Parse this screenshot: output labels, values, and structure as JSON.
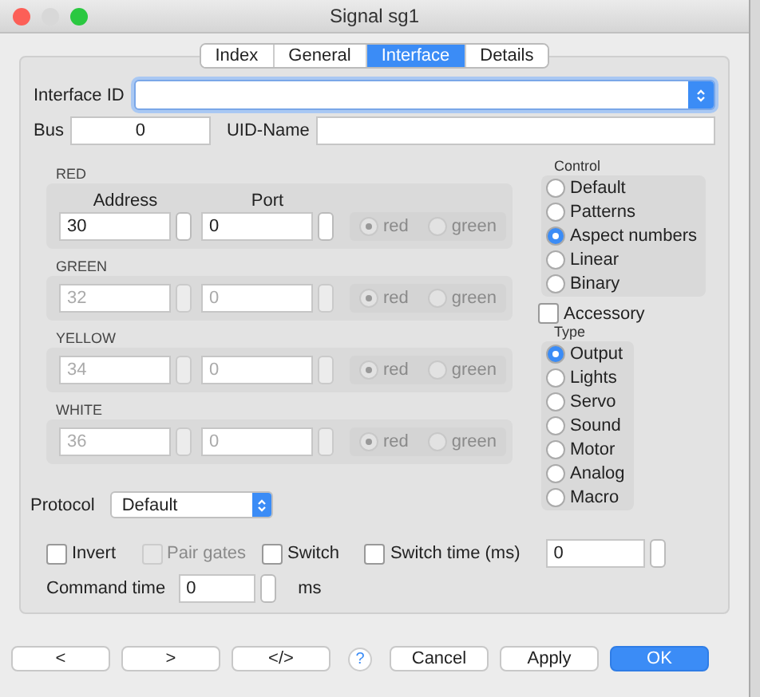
{
  "window": {
    "title": "Signal sg1"
  },
  "tabs": [
    {
      "label": "Index",
      "selected": false
    },
    {
      "label": "General",
      "selected": false
    },
    {
      "label": "Interface",
      "selected": true
    },
    {
      "label": "Details",
      "selected": false
    }
  ],
  "interface_id": {
    "label": "Interface ID"
  },
  "bus": {
    "label": "Bus",
    "value": "0"
  },
  "uid_name": {
    "label": "UID-Name"
  },
  "address_header": "Address",
  "port_header": "Port",
  "outputs": [
    {
      "label": "RED",
      "disabled": false,
      "address": "30",
      "port": "0",
      "options": [
        {
          "label": "red",
          "selected": true
        },
        {
          "label": "green",
          "selected": false
        }
      ]
    },
    {
      "label": "GREEN",
      "disabled": true,
      "address": "32",
      "port": "0",
      "options": [
        {
          "label": "red",
          "selected": true
        },
        {
          "label": "green",
          "selected": false
        }
      ]
    },
    {
      "label": "YELLOW",
      "disabled": true,
      "address": "34",
      "port": "0",
      "options": [
        {
          "label": "red",
          "selected": true
        },
        {
          "label": "green",
          "selected": false
        }
      ]
    },
    {
      "label": "WHITE",
      "disabled": true,
      "address": "36",
      "port": "0",
      "options": [
        {
          "label": "red",
          "selected": true
        },
        {
          "label": "green",
          "selected": false
        }
      ]
    }
  ],
  "control": {
    "title": "Control",
    "options": [
      {
        "label": "Default",
        "selected": false
      },
      {
        "label": "Patterns",
        "selected": false
      },
      {
        "label": "Aspect numbers",
        "selected": true
      },
      {
        "label": "Linear",
        "selected": false
      },
      {
        "label": "Binary",
        "selected": false
      }
    ]
  },
  "accessory": {
    "label": "Accessory",
    "checked": false
  },
  "type": {
    "title": "Type",
    "options": [
      {
        "label": "Output",
        "selected": true
      },
      {
        "label": "Lights",
        "selected": false
      },
      {
        "label": "Servo",
        "selected": false
      },
      {
        "label": "Sound",
        "selected": false
      },
      {
        "label": "Motor",
        "selected": false
      },
      {
        "label": "Analog",
        "selected": false
      },
      {
        "label": "Macro",
        "selected": false
      }
    ]
  },
  "protocol": {
    "label": "Protocol",
    "value": "Default"
  },
  "flags": [
    {
      "label": "Invert",
      "checked": false,
      "disabled": false
    },
    {
      "label": "Pair gates",
      "checked": false,
      "disabled": true
    },
    {
      "label": "Switch",
      "checked": false,
      "disabled": false
    },
    {
      "label": "Switch time (ms)",
      "checked": false,
      "disabled": false
    }
  ],
  "switch_time": {
    "value": "0"
  },
  "command_time": {
    "label": "Command time",
    "value": "0",
    "unit": "ms"
  },
  "buttons": [
    {
      "label": "<",
      "kind": "plain"
    },
    {
      "label": ">",
      "kind": "plain"
    },
    {
      "label": "</>",
      "kind": "plain"
    },
    {
      "label": "?",
      "kind": "help"
    },
    {
      "label": "Cancel",
      "kind": "plain"
    },
    {
      "label": "Apply",
      "kind": "plain"
    },
    {
      "label": "OK",
      "kind": "default"
    }
  ]
}
